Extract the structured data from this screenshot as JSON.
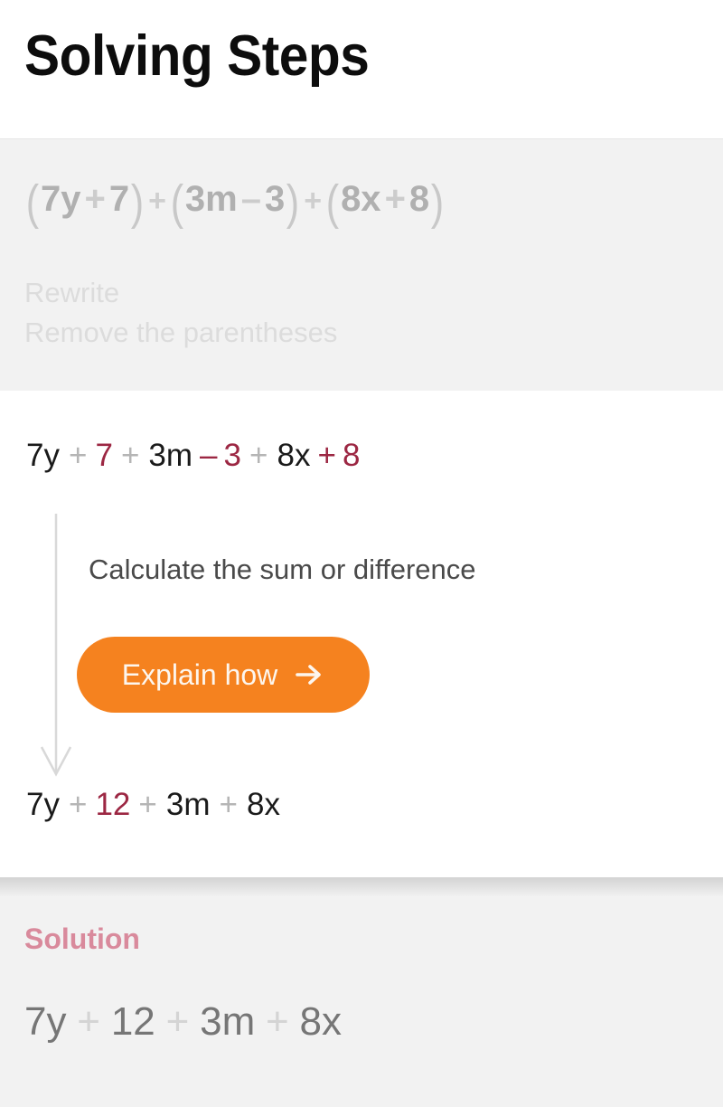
{
  "header": {
    "title": "Solving Steps"
  },
  "problem": {
    "expression_plain": "(7y + 7) + (3m - 3) + (8x + 8)",
    "parts": {
      "open1": "(",
      "g1_a": "7y",
      "g1_op": "+",
      "g1_b": "7",
      "close1": ")",
      "join1": "+",
      "open2": "(",
      "g2_a": "3m",
      "g2_op": "–",
      "g2_b": "3",
      "close2": ")",
      "join2": "+",
      "open3": "(",
      "g3_a": "8x",
      "g3_op": "+",
      "g3_b": "8",
      "close3": ")"
    },
    "rewrite_label": "Rewrite",
    "rewrite_detail": "Remove the parentheses"
  },
  "work": {
    "step1": {
      "plain": "7y + 7 + 3m - 3 + 8x + 8",
      "tokens": [
        {
          "text": "7y",
          "style": "plain"
        },
        {
          "text": "+",
          "style": "gray"
        },
        {
          "text": "7",
          "style": "highlight"
        },
        {
          "text": "+",
          "style": "gray"
        },
        {
          "text": "3m",
          "style": "plain"
        },
        {
          "text": "–",
          "style": "highlight"
        },
        {
          "text": "3",
          "style": "highlight"
        },
        {
          "text": "+",
          "style": "gray"
        },
        {
          "text": "8x",
          "style": "plain"
        },
        {
          "text": "+",
          "style": "highlight"
        },
        {
          "text": "8",
          "style": "highlight"
        }
      ]
    },
    "hint": "Calculate the sum or difference",
    "explain_button": {
      "label": "Explain how",
      "icon": "arrow-right-icon"
    },
    "step2": {
      "plain": "7y + 12 + 3m + 8x",
      "tokens": [
        {
          "text": "7y",
          "style": "plain"
        },
        {
          "text": "+",
          "style": "gray"
        },
        {
          "text": "12",
          "style": "highlight"
        },
        {
          "text": "+",
          "style": "gray"
        },
        {
          "text": "3m",
          "style": "plain"
        },
        {
          "text": "+",
          "style": "gray"
        },
        {
          "text": "8x",
          "style": "plain"
        }
      ]
    },
    "flow_arrow_icon": "arrow-down-icon"
  },
  "solution": {
    "label": "Solution",
    "expression_plain": "7y + 12 + 3m + 8x",
    "tokens": [
      {
        "text": "7y",
        "style": "plain"
      },
      {
        "text": "+",
        "style": "gray"
      },
      {
        "text": "12",
        "style": "plain"
      },
      {
        "text": "+",
        "style": "gray"
      },
      {
        "text": "3m",
        "style": "plain"
      },
      {
        "text": "+",
        "style": "gray"
      },
      {
        "text": "8x",
        "style": "plain"
      }
    ]
  },
  "colors": {
    "highlight": "#9c2743",
    "accent_orange": "#f5821f",
    "solution_pink": "#d98a9c",
    "panel_gray": "#f2f2f2",
    "muted_gray": "#b3b3b3"
  }
}
